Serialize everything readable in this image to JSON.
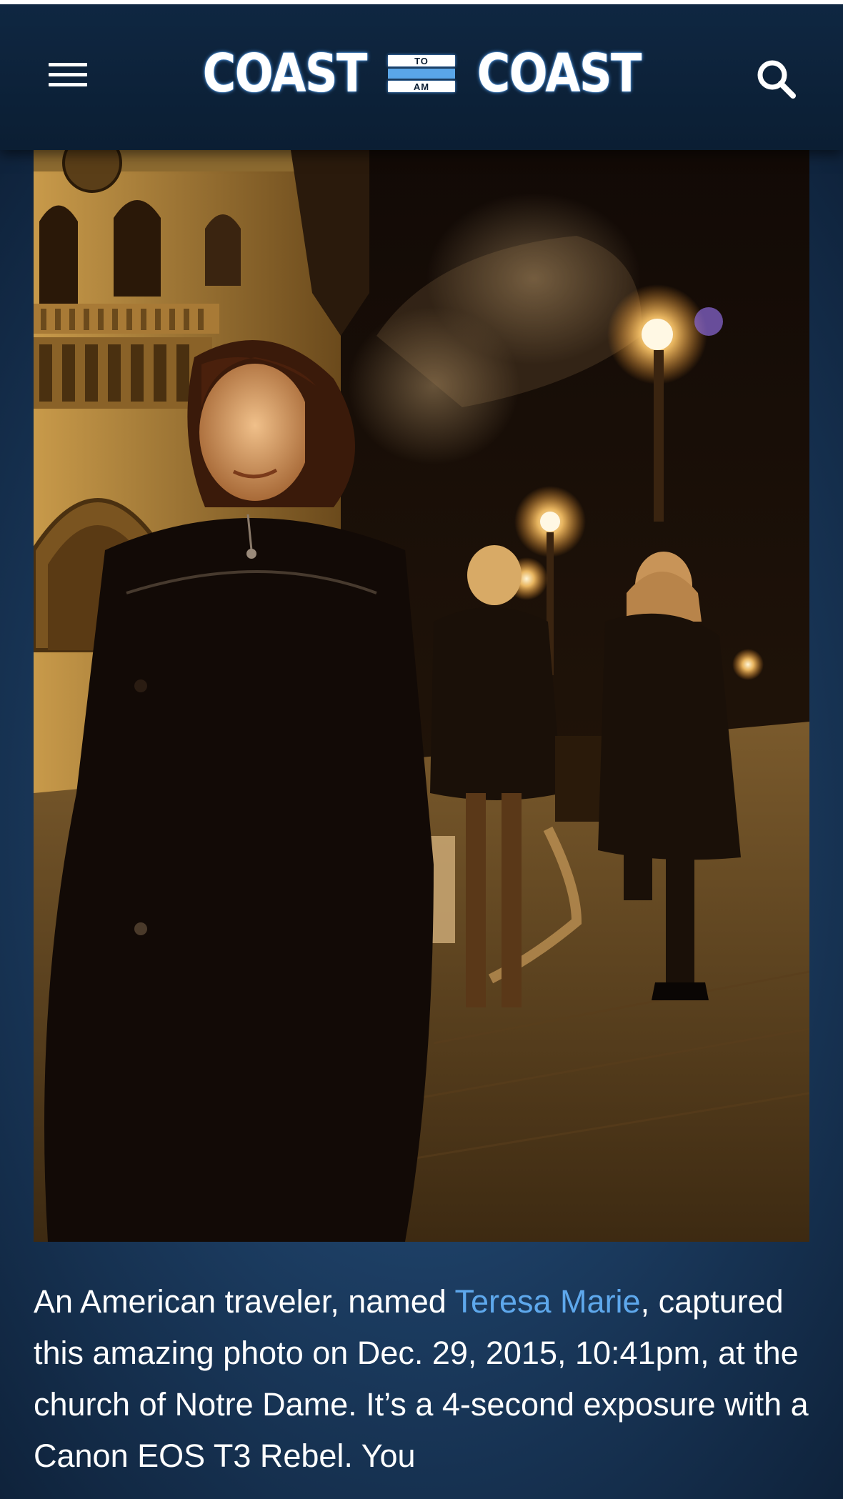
{
  "header": {
    "logo": {
      "left_word": "COAST",
      "badge_top": "TO",
      "badge_bottom": "AM",
      "right_word": "COAST"
    },
    "menu_icon": "hamburger-menu-icon",
    "search_icon": "search-icon"
  },
  "article": {
    "photo_alt": "Night photo at Notre Dame with ghostly figure",
    "caption": {
      "text_before_link": "An American traveler, named ",
      "link_text": "Teresa Marie",
      "text_after_link": ", captured this amazing photo on Dec. 29, 2015, 10:41pm, at the church of Notre Dame. It’s a 4-second exposure with a Canon EOS T3 Rebel. You"
    }
  },
  "colors": {
    "header_bg": "#0b1e33",
    "page_bg": "#1c3d62",
    "link": "#5ea8ec",
    "logo_accent": "#5aa6e8"
  }
}
